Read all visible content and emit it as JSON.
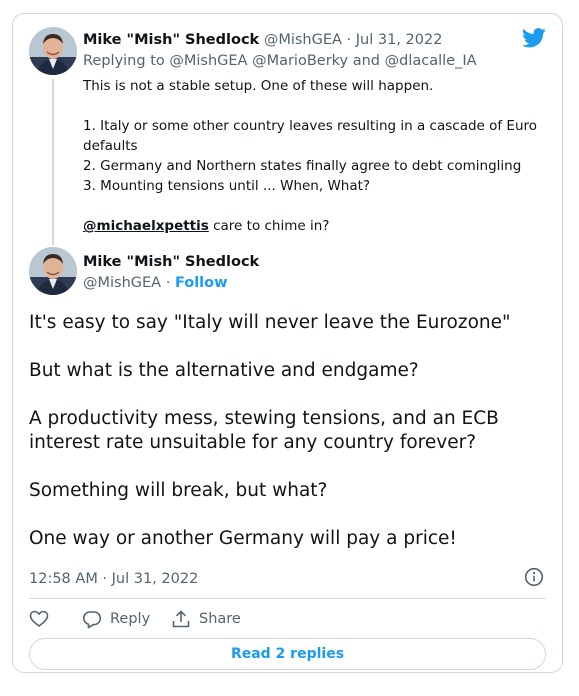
{
  "colors": {
    "accent": "#1d9bf0",
    "text": "#0f1419",
    "muted": "#536471",
    "border": "#cfd9de"
  },
  "quoted_tweet": {
    "author_name": "Mike \"Mish\" Shedlock",
    "author_handle": "@MishGEA",
    "date": "· Jul 31, 2022",
    "replying_prefix": "Replying to",
    "replying_to": "@MishGEA @MarioBerky and @dlacalle_IA",
    "lines": [
      "This is not a stable setup. One of these will happen.",
      "1. Italy or some other country leaves resulting in a cascade of Euro defaults",
      "2. Germany and Northern states finally agree to debt comingling",
      "3. Mounting tensions until ... When, What?"
    ],
    "mention": "@michaelxpettis",
    "mention_suffix": "care to chime in?"
  },
  "main_tweet": {
    "author_name": "Mike \"Mish\" Shedlock",
    "author_handle": "@MishGEA",
    "separator": "·",
    "follow_label": "Follow",
    "paragraphs": [
      "It's easy to say \"Italy will never leave the Eurozone\"",
      "But what is the alternative and endgame?",
      "A productivity mess, stewing tensions, and an ECB interest rate unsuitable for any country forever?",
      "Something will break, but what?",
      "One way or another Germany will pay a price!"
    ],
    "timestamp": "12:58 AM · Jul 31, 2022"
  },
  "actions": {
    "like_icon": "heart-icon",
    "reply_label": "Reply",
    "share_label": "Share"
  },
  "read_replies_label": "Read 2 replies",
  "icons": [
    "twitter-bird-icon",
    "info-icon",
    "heart-icon",
    "reply-bubble-icon",
    "share-icon"
  ]
}
